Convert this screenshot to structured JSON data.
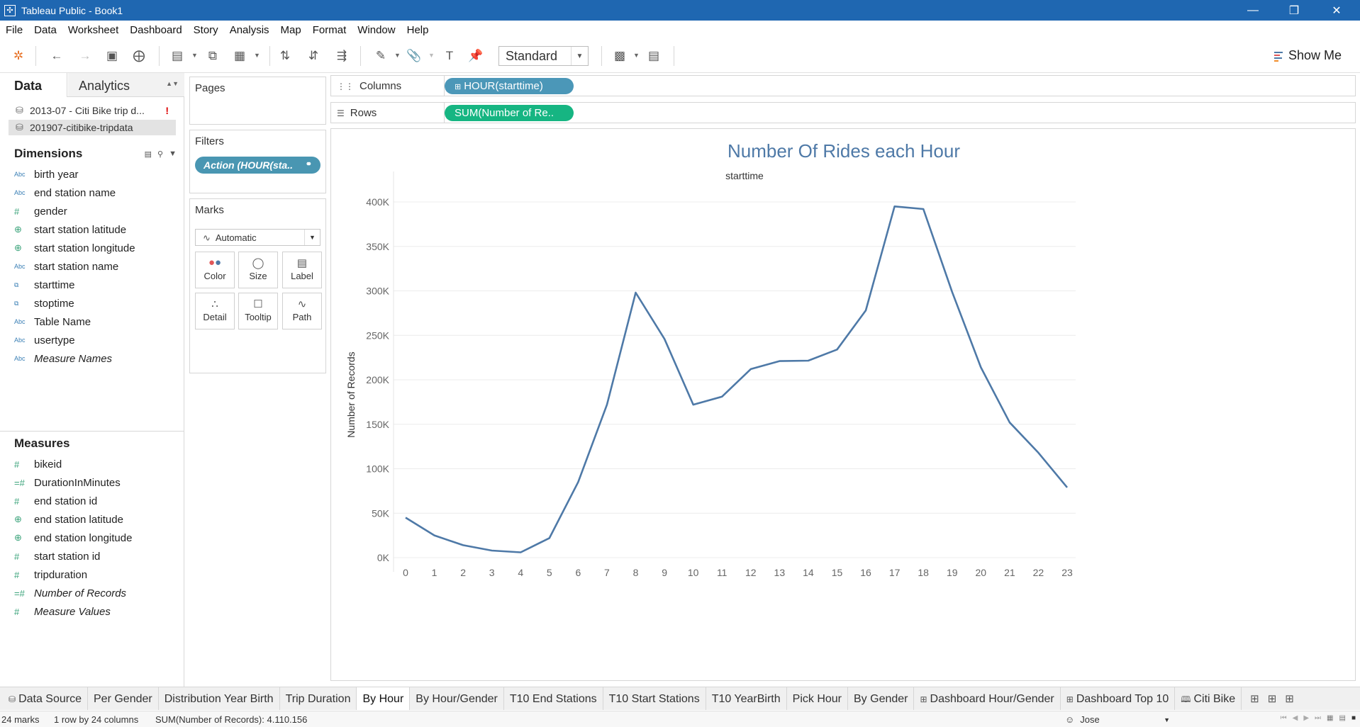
{
  "window": {
    "title": "Tableau Public - Book1"
  },
  "menu": [
    "File",
    "Data",
    "Worksheet",
    "Dashboard",
    "Story",
    "Analysis",
    "Map",
    "Format",
    "Window",
    "Help"
  ],
  "toolbar": {
    "fit_value": "Standard",
    "show_me_label": "Show Me"
  },
  "data_pane": {
    "tab_data": "Data",
    "tab_analytics": "Analytics",
    "datasources": [
      {
        "name": "2013-07 - Citi Bike trip d...",
        "warning": "!"
      },
      {
        "name": "201907-citibike-tripdata"
      }
    ],
    "dimensions_label": "Dimensions",
    "dimensions": [
      {
        "name": "birth year",
        "type": "Abc"
      },
      {
        "name": "end station name",
        "type": "Abc"
      },
      {
        "name": "gender",
        "type": "#"
      },
      {
        "name": "start station latitude",
        "type": "geo"
      },
      {
        "name": "start station longitude",
        "type": "geo"
      },
      {
        "name": "start station name",
        "type": "Abc"
      },
      {
        "name": "starttime",
        "type": "date"
      },
      {
        "name": "stoptime",
        "type": "date"
      },
      {
        "name": "Table Name",
        "type": "Abc"
      },
      {
        "name": "usertype",
        "type": "Abc"
      },
      {
        "name": "Measure Names",
        "type": "Abc",
        "italic": true
      }
    ],
    "measures_label": "Measures",
    "measures": [
      {
        "name": "bikeid",
        "type": "#"
      },
      {
        "name": "DurationInMinutes",
        "type": "=#"
      },
      {
        "name": "end station id",
        "type": "#"
      },
      {
        "name": "end station latitude",
        "type": "geo"
      },
      {
        "name": "end station longitude",
        "type": "geo"
      },
      {
        "name": "start station id",
        "type": "#"
      },
      {
        "name": "tripduration",
        "type": "#"
      },
      {
        "name": "Number of Records",
        "type": "=#",
        "italic": true
      },
      {
        "name": "Measure Values",
        "type": "#",
        "italic": true
      }
    ]
  },
  "cards": {
    "pages_label": "Pages",
    "filters_label": "Filters",
    "filter_pill": "Action (HOUR(sta..",
    "marks_label": "Marks",
    "mark_type": "Automatic",
    "mark_buttons": [
      "Color",
      "Size",
      "Label",
      "Detail",
      "Tooltip",
      "Path"
    ]
  },
  "shelves": {
    "columns_label": "Columns",
    "columns_pill": "HOUR(starttime)",
    "rows_label": "Rows",
    "rows_pill": "SUM(Number of Re.."
  },
  "chart_data": {
    "type": "line",
    "title": "Number Of Rides each Hour",
    "header": "starttime",
    "ylabel": "Number of Records",
    "ylim": [
      0,
      400000
    ],
    "yticks": [
      "0K",
      "50K",
      "100K",
      "150K",
      "200K",
      "250K",
      "300K",
      "350K",
      "400K"
    ],
    "color": "#4e79a7",
    "categories": [
      "0",
      "1",
      "2",
      "3",
      "4",
      "5",
      "6",
      "7",
      "8",
      "9",
      "10",
      "11",
      "12",
      "13",
      "14",
      "15",
      "16",
      "17",
      "18",
      "19",
      "20",
      "21",
      "22",
      "23"
    ],
    "values": [
      45000,
      25000,
      14000,
      8000,
      6000,
      22000,
      85000,
      172000,
      298000,
      246000,
      172000,
      181000,
      212000,
      221000,
      221500,
      234000,
      278000,
      395000,
      392000,
      299000,
      214000,
      152000,
      118000,
      79000
    ]
  },
  "sheet_tabs": [
    {
      "label": "Data Source",
      "icon": "datasource"
    },
    {
      "label": "Per Gender"
    },
    {
      "label": "Distribution Year Birth"
    },
    {
      "label": "Trip Duration"
    },
    {
      "label": "By Hour",
      "active": true
    },
    {
      "label": "By Hour/Gender"
    },
    {
      "label": "T10 End Stations"
    },
    {
      "label": "T10 Start Stations"
    },
    {
      "label": "T10 YearBirth"
    },
    {
      "label": "Pick Hour"
    },
    {
      "label": "By Gender"
    },
    {
      "label": "Dashboard Hour/Gender",
      "icon": "dashboard"
    },
    {
      "label": "Dashboard Top 10",
      "icon": "dashboard"
    },
    {
      "label": "Citi Bike",
      "icon": "story"
    }
  ],
  "status": {
    "marks": "24 marks",
    "dims": "1 row by 24 columns",
    "sum": "SUM(Number of Records): 4.110.156",
    "user": "Jose"
  }
}
